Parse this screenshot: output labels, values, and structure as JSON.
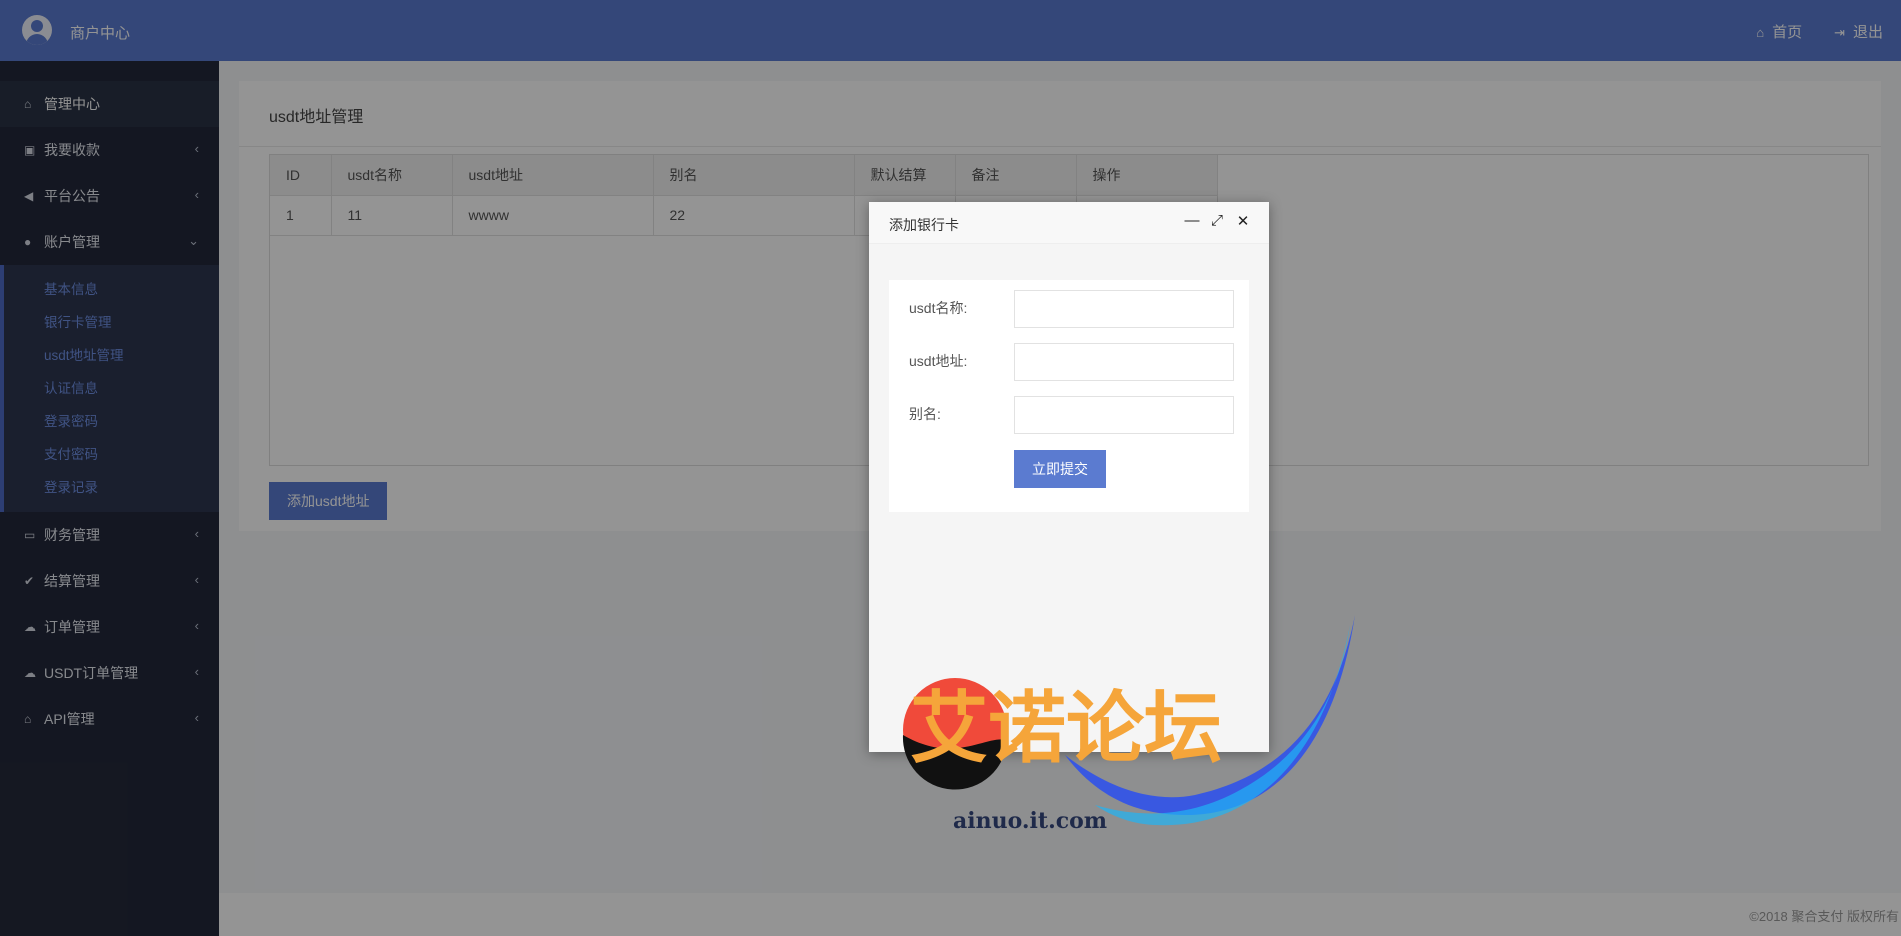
{
  "header": {
    "brand": "商户中心",
    "nav": [
      {
        "icon": "home-icon",
        "label": "首页"
      },
      {
        "icon": "logout-icon",
        "label": "退出"
      }
    ]
  },
  "sidebar": {
    "items": [
      {
        "label": "管理中心",
        "icon": "home-icon"
      },
      {
        "label": "我要收款",
        "icon": "lock-icon"
      },
      {
        "label": "平台公告",
        "icon": "volume-icon"
      },
      {
        "label": "账户管理",
        "icon": "user-icon"
      },
      {
        "label": "财务管理",
        "icon": "money-icon"
      },
      {
        "label": "结算管理",
        "icon": "check-icon"
      },
      {
        "label": "订单管理",
        "icon": "cloud-icon"
      },
      {
        "label": "USDT订单管理",
        "icon": "cloud-icon"
      },
      {
        "label": "API管理",
        "icon": "bank-icon"
      }
    ],
    "submenu": [
      "基本信息",
      "银行卡管理",
      "usdt地址管理",
      "认证信息",
      "登录密码",
      "支付密码",
      "登录记录"
    ]
  },
  "main": {
    "title": "usdt地址管理",
    "table": {
      "columns": [
        "ID",
        "usdt名称",
        "usdt地址",
        "别名",
        "默认结算",
        "备注",
        "操作"
      ],
      "rows": [
        {
          "id": "1",
          "name": "11",
          "address": "wwww",
          "alias": "22",
          "default": "",
          "remark": ""
        }
      ]
    },
    "add_button": "添加usdt地址"
  },
  "modal": {
    "title": "添加银行卡",
    "fields": [
      {
        "label": "usdt名称:",
        "value": ""
      },
      {
        "label": "usdt地址:",
        "value": ""
      },
      {
        "label": "别名:",
        "value": ""
      }
    ],
    "submit": "立即提交"
  },
  "watermark": {
    "text": "艾诺论坛",
    "domain": "ainuo.it.com"
  },
  "footer": {
    "copyright": "©2018 聚合支付 版权所有"
  },
  "colors": {
    "primary": "#5b7bd0",
    "sidebar_bg": "#24293b",
    "submenu_text": "#6e8fe3"
  }
}
